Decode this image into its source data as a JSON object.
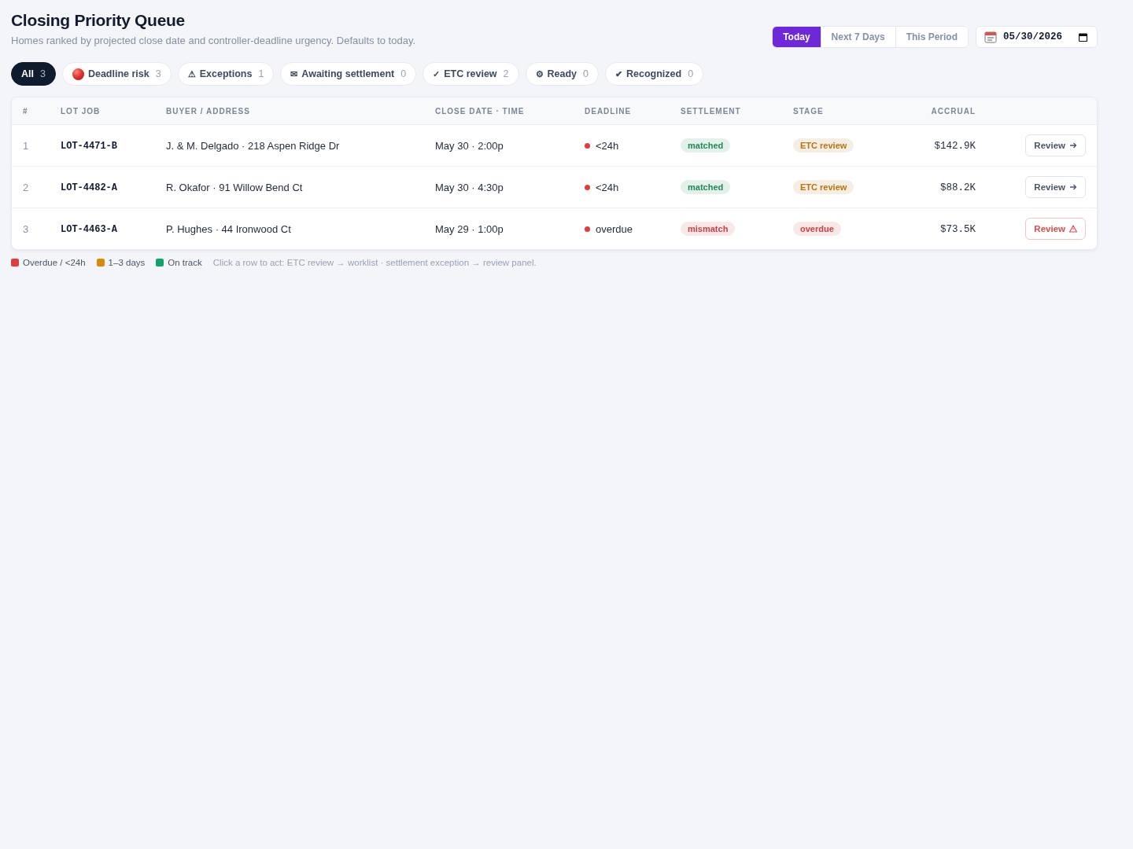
{
  "header": {
    "title": "Closing Priority Queue",
    "subtitle": "Homes ranked by projected close date and controller-deadline urgency. Defaults to today."
  },
  "range_tabs": [
    {
      "label": "Today",
      "selected": true
    },
    {
      "label": "Next 7 Days",
      "selected": false
    },
    {
      "label": "This Period",
      "selected": false
    }
  ],
  "date_field": {
    "value": "05/30/2026"
  },
  "filters": [
    {
      "label": "All",
      "count": "3",
      "selected": true
    },
    {
      "kind": "dot",
      "label": "Deadline risk",
      "count": "3",
      "selected": false
    },
    {
      "icon": "⚠",
      "label": "Exceptions",
      "count": "1",
      "selected": false
    },
    {
      "icon": "✉",
      "label": "Awaiting settlement",
      "count": "0",
      "selected": false
    },
    {
      "icon": "✓",
      "label": "ETC review",
      "count": "2",
      "selected": false
    },
    {
      "icon": "⚙",
      "label": "Ready",
      "count": "0",
      "selected": false
    },
    {
      "icon": "✔",
      "label": "Recognized",
      "count": "0",
      "selected": false
    }
  ],
  "table": {
    "columns": [
      "#",
      "LOT JOB",
      "BUYER / ADDRESS",
      "CLOSE DATE · TIME",
      "DEADLINE",
      "SETTLEMENT",
      "STAGE",
      "ACCRUAL"
    ],
    "rows": [
      {
        "rank": "1",
        "lot": "LOT-4471-B",
        "buyer": "J. & M. Delgado · 218 Aspen Ridge Dr",
        "close": "May 30 · 2:00p",
        "deadline": "<24h",
        "settlement": {
          "label": "matched",
          "color": "#1f8a55"
        },
        "stage": {
          "label": "ETC review",
          "color": "#b7740f"
        },
        "accrual": "$142.9K",
        "action": {
          "label": "Review",
          "alert": false
        }
      },
      {
        "rank": "2",
        "lot": "LOT-4482-A",
        "buyer": "R. Okafor · 91 Willow Bend Ct",
        "close": "May 30 · 4:30p",
        "deadline": "<24h",
        "settlement": {
          "label": "matched",
          "color": "#1f8a55"
        },
        "stage": {
          "label": "ETC review",
          "color": "#b7740f"
        },
        "accrual": "$88.2K",
        "action": {
          "label": "Review",
          "alert": false
        }
      },
      {
        "rank": "3",
        "lot": "LOT-4463-A",
        "buyer": "P. Hughes · 44 Ironwood Ct",
        "close": "May 29 · 1:00p",
        "deadline": "overdue",
        "settlement": {
          "label": "mismatch",
          "color": "#cf3e3e"
        },
        "stage": {
          "label": "overdue",
          "color": "#cf3e3e"
        },
        "accrual": "$73.5K",
        "action": {
          "label": "Review",
          "alert": true
        }
      }
    ]
  },
  "legend": [
    {
      "label": "Overdue / <24h",
      "color": "#e03e3e"
    },
    {
      "label": "1–3 days",
      "color": "#d98a0b"
    },
    {
      "label": "On track",
      "color": "#12a36a"
    }
  ],
  "hint": "Click a row to act: ETC review → worklist · settlement exception → review panel."
}
